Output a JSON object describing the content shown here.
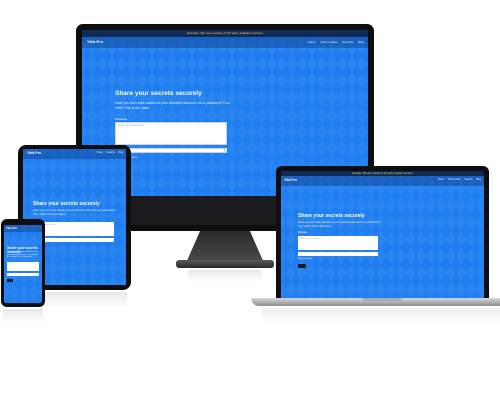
{
  "site": {
    "brand": "Yikir.Pro",
    "banner": "Example: We use a variety of 3rd party analytics services",
    "nav_links": [
      "Home",
      "How it works",
      "Security",
      "Blog"
    ]
  },
  "hero": {
    "title": "Share your secrets securely",
    "subtitle": "Have you ever been asked for your sensitive data such as a password? If so, Hello! This is the place.",
    "message_label": "Message",
    "message_placeholder": "Write your secret here...",
    "expiry_placeholder": "Expire in...",
    "checkbox_label": "Read only once",
    "submit_label": "Create"
  },
  "colors": {
    "accent": "#1f7ef0",
    "bezel": "#0e0e10",
    "banner_bg": "#0f2a55",
    "banner_text": "#ffdd55"
  }
}
